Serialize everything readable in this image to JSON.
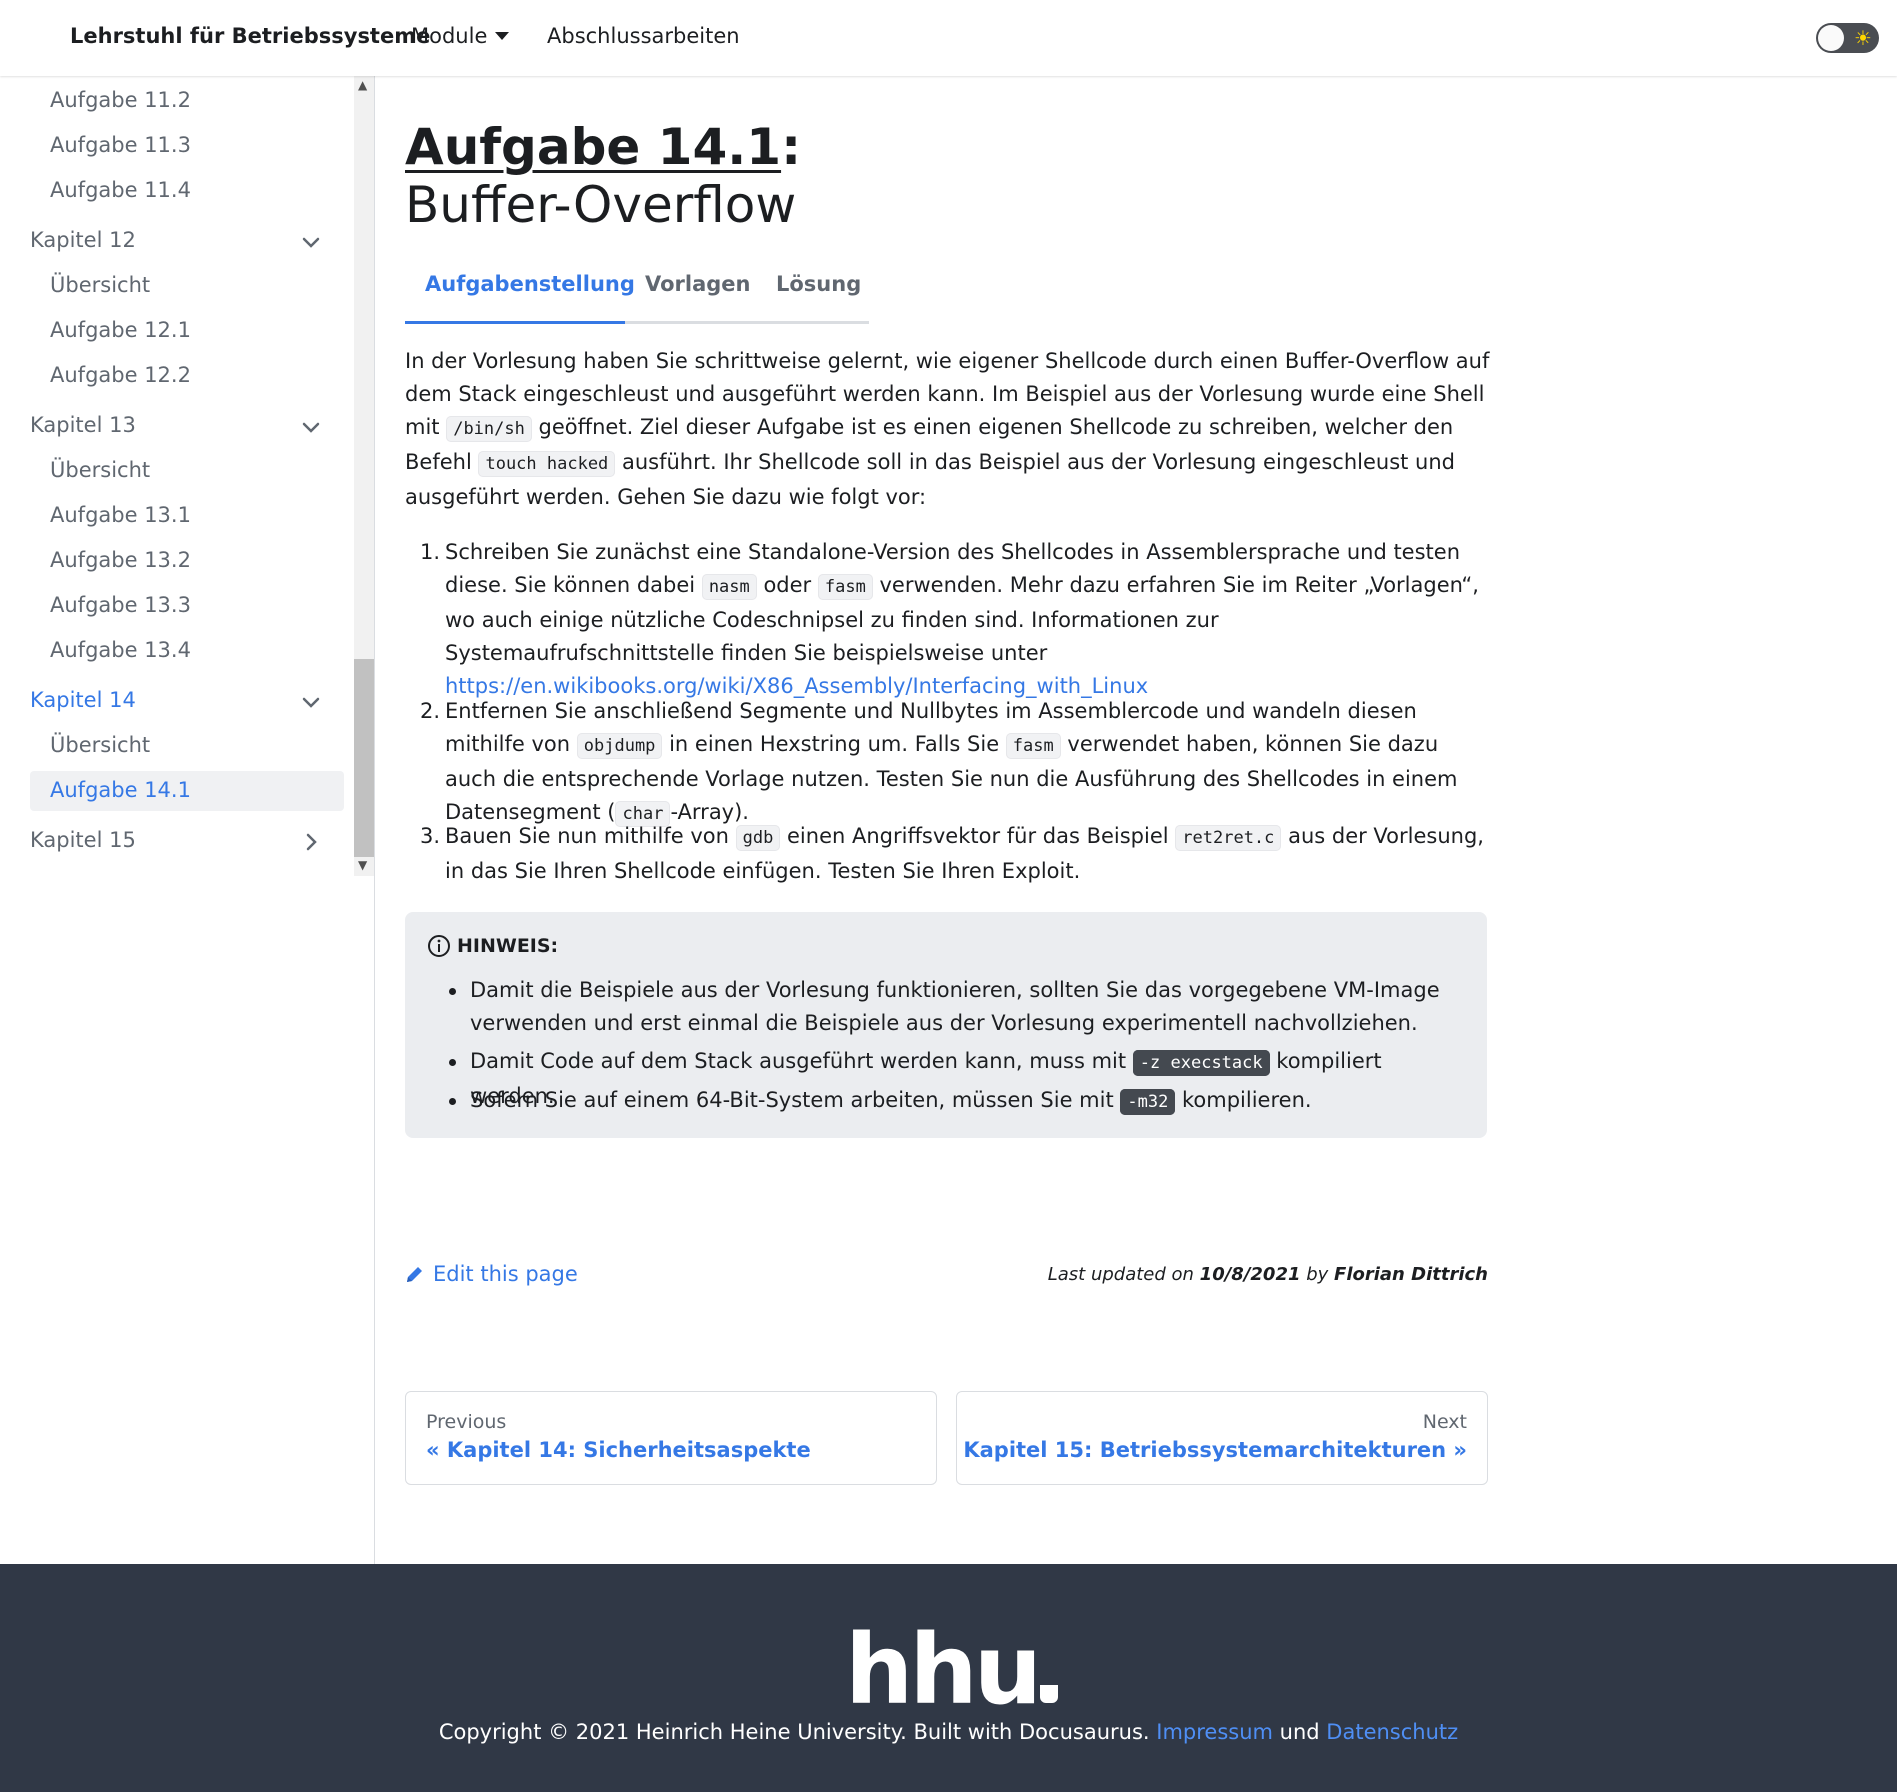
{
  "navbar": {
    "brand": "Lehrstuhl für Betriebssysteme",
    "modules": "Module",
    "theses": "Abschlussarbeiten"
  },
  "sidebar": {
    "items": [
      {
        "label": "Aufgabe 11.2"
      },
      {
        "label": "Aufgabe 11.3"
      },
      {
        "label": "Aufgabe 11.4"
      },
      {
        "label": "Kapitel 12"
      },
      {
        "label": "Übersicht"
      },
      {
        "label": "Aufgabe 12.1"
      },
      {
        "label": "Aufgabe 12.2"
      },
      {
        "label": "Kapitel 13"
      },
      {
        "label": "Übersicht"
      },
      {
        "label": "Aufgabe 13.1"
      },
      {
        "label": "Aufgabe 13.2"
      },
      {
        "label": "Aufgabe 13.3"
      },
      {
        "label": "Aufgabe 13.4"
      },
      {
        "label": "Kapitel 14"
      },
      {
        "label": "Übersicht"
      },
      {
        "label": "Aufgabe 14.1"
      },
      {
        "label": "Kapitel 15"
      }
    ]
  },
  "page": {
    "title_number": "Aufgabe 14.1",
    "title_colon": ":",
    "subtitle": "Buffer-Overflow"
  },
  "tabs": [
    {
      "label": "Aufgabenstellung"
    },
    {
      "label": "Vorlagen"
    },
    {
      "label": "Lösung"
    }
  ],
  "intro": {
    "t1": "In der Vorlesung haben Sie schrittweise gelernt, wie eigener Shellcode durch einen Buffer-Overflow auf dem Stack eingeschleust und ausgeführt werden kann. Im Beispiel aus der Vorlesung wurde eine Shell mit ",
    "c1": "/bin/sh",
    "t2": " geöffnet. Ziel dieser Aufgabe ist es einen eigenen Shellcode zu schreiben, welcher den Befehl ",
    "c2": "touch hacked",
    "t3": " ausführt. Ihr Shellcode soll in das Beispiel aus der Vorlesung eingeschleust und ausgeführt werden. Gehen Sie dazu wie folgt vor:"
  },
  "steps": [
    {
      "num": "1.",
      "t1": "Schreiben Sie zunächst eine Standalone-Version des Shellcodes in Assemblersprache und testen diese. Sie können dabei ",
      "c1": "nasm",
      "t2": " oder ",
      "c2": "fasm",
      "t3": " verwenden. Mehr dazu erfahren Sie im Reiter „Vorlagen“, wo auch einige nützliche Codeschnipsel zu finden sind. Informationen zur Systemaufrufschnittstelle finden Sie beispielsweise unter ",
      "link": "https://en.wikibooks.org/wiki/X86_Assembly/Interfacing_with_Linux"
    },
    {
      "num": "2.",
      "t1": "Entfernen Sie anschließend Segmente und Nullbytes im Assemblercode und wandeln diesen mithilfe von ",
      "c1": "objdump",
      "t2": " in einen Hexstring um. Falls Sie ",
      "c2": "fasm",
      "t3": " verwendet haben, können Sie dazu auch die entsprechende Vorlage nutzen. Testen Sie nun die Ausführung des Shellcodes in einem Datensegment (",
      "c3": "char",
      "t4": "-Array)."
    },
    {
      "num": "3.",
      "t1": "Bauen Sie nun mithilfe von ",
      "c1": "gdb",
      "t2": " einen Angriffsvektor für das Beispiel ",
      "c2": "ret2ret.c",
      "t3": " aus der Vorlesung, in das Sie Ihren Shellcode einfügen. Testen Sie Ihren Exploit."
    }
  ],
  "note": {
    "heading": "HINWEIS:",
    "b1": "Damit die Beispiele aus der Vorlesung funktionieren, sollten Sie das vorgegebene VM-Image verwenden und erst einmal die Beispiele aus der Vorlesung experimentell nachvollziehen.",
    "b2_t1": "Damit Code auf dem Stack ausgeführt werden kann, muss mit ",
    "b2_c": "-z execstack",
    "b2_t2": " kompiliert werden.",
    "b3_t1": "Sofern Sie auf einem 64-Bit-System arbeiten, müssen Sie mit ",
    "b3_c": "-m32",
    "b3_t2": " kompilieren."
  },
  "meta": {
    "edit": "Edit this page",
    "updated_prefix": "Last updated on ",
    "updated_date": "10/8/2021",
    "updated_by": " by ",
    "updated_author": "Florian Dittrich"
  },
  "pager": {
    "prev_sub": "Previous",
    "prev_label": "« Kapitel 14: Sicherheitsaspekte",
    "next_sub": "Next",
    "next_label": "Kapitel 15: Betriebssystemarchitekturen »"
  },
  "footer": {
    "logo": "hhu",
    "copyright": "Copyright © 2021 Heinrich Heine University. Built with Docusaurus. ",
    "impressum": "Impressum",
    "und": " und ",
    "datenschutz": "Datenschutz"
  },
  "colors": {
    "accent": "#3578e5",
    "footer_bg": "#303846",
    "admonition_bg": "#ebedf0"
  }
}
